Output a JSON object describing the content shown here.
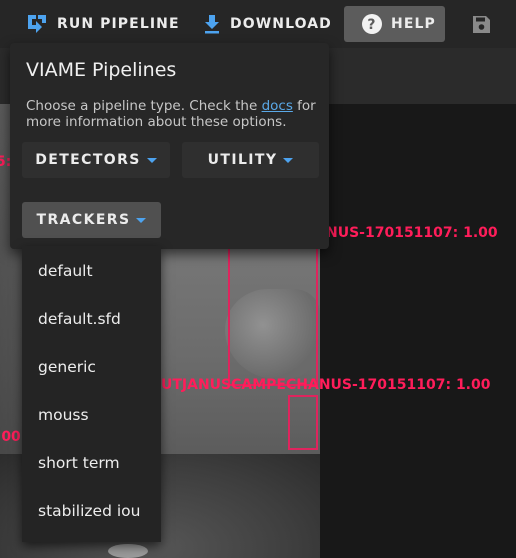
{
  "toolbar": {
    "run_pipeline": {
      "label": "RUN PIPELINE",
      "icon": "pipeline-icon"
    },
    "download": {
      "label": "DOWNLOAD",
      "icon": "download-icon"
    },
    "help": {
      "label": "HELP",
      "icon": "help-circle-icon"
    },
    "save": {
      "icon": "save-icon"
    }
  },
  "menu": {
    "title": "VIAME Pipelines",
    "description_before": "Choose a pipeline type. Check the ",
    "description_link": "docs",
    "description_after": " for more information about these options.",
    "categories": [
      {
        "label": "DETECTORS"
      },
      {
        "label": "UTILITY"
      },
      {
        "label": "TRACKERS",
        "open": true
      }
    ]
  },
  "dropdown": {
    "items": [
      "default",
      "default.sfd",
      "generic",
      "mouss",
      "short term",
      "stabilized iou"
    ]
  },
  "detections": [
    {
      "label": "NUS-170151107: 1.00"
    },
    {
      "label": "UTJANUSCAMPECHANUS-170151107: 1.00"
    },
    {
      "label": ".00"
    },
    {
      "label": "5:"
    }
  ],
  "colors": {
    "accent": "#4da3ef",
    "detection": "#e0245e",
    "link": "#5aa9e8"
  }
}
